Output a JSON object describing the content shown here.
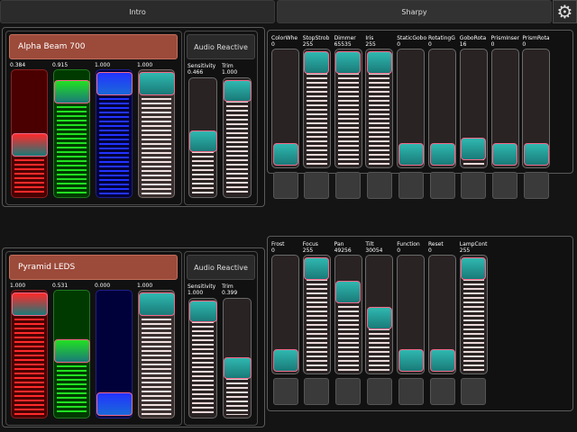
{
  "tabs": [
    {
      "label": "Intro",
      "active": false
    },
    {
      "label": "Sharpy",
      "active": true
    }
  ],
  "settings_icon": "gear-icon",
  "fixtures": [
    {
      "name": "Alpha Beam 700",
      "audio_label": "Audio Reactive",
      "faders": [
        {
          "value": "0.384",
          "color": "red",
          "level": 0.384
        },
        {
          "value": "0.915",
          "color": "green",
          "level": 0.915
        },
        {
          "value": "1.000",
          "color": "blue",
          "level": 1.0
        },
        {
          "value": "1.000",
          "color": "white",
          "level": 1.0
        }
      ],
      "audio": [
        {
          "label": "Sensitivity",
          "value": "0.466",
          "level": 0.466
        },
        {
          "label": "Trim",
          "value": "1.000",
          "level": 1.0
        }
      ]
    },
    {
      "name": "Pyramid LEDS",
      "audio_label": "Audio Reactive",
      "faders": [
        {
          "value": "1.000",
          "color": "red",
          "level": 1.0
        },
        {
          "value": "0.531",
          "color": "green",
          "level": 0.531
        },
        {
          "value": "0.000",
          "color": "blue",
          "level": 0.0
        },
        {
          "value": "1.000",
          "color": "white",
          "level": 1.0
        }
      ],
      "audio": [
        {
          "label": "Sensitivity",
          "value": "1.000",
          "level": 1.0
        },
        {
          "label": "Trim",
          "value": "0.399",
          "level": 0.399
        }
      ]
    }
  ],
  "channels_top": [
    {
      "label": "ColorWhe",
      "value": "0",
      "level": 0.0
    },
    {
      "label": "StopStrob",
      "value": "255",
      "level": 1.0
    },
    {
      "label": "Dimmer",
      "value": "65535",
      "level": 1.0
    },
    {
      "label": "Iris",
      "value": "255",
      "level": 1.0
    },
    {
      "label": "StaticGobo",
      "value": "0",
      "level": 0.0
    },
    {
      "label": "RotatingG",
      "value": "0",
      "level": 0.0
    },
    {
      "label": "GoboRota",
      "value": "16",
      "level": 0.063
    },
    {
      "label": "PrismInser",
      "value": "0",
      "level": 0.0
    },
    {
      "label": "PrismRota",
      "value": "0",
      "level": 0.0
    }
  ],
  "channels_bottom": [
    {
      "label": "Frost",
      "value": "0",
      "level": 0.0
    },
    {
      "label": "Focus",
      "value": "255",
      "level": 1.0
    },
    {
      "label": "Pan",
      "value": "49256",
      "level": 0.75
    },
    {
      "label": "Tilt",
      "value": "30054",
      "level": 0.46
    },
    {
      "label": "Function",
      "value": "0",
      "level": 0.0
    },
    {
      "label": "Reset",
      "value": "0",
      "level": 0.0
    },
    {
      "label": "LampCont",
      "value": "255",
      "level": 1.0
    }
  ]
}
